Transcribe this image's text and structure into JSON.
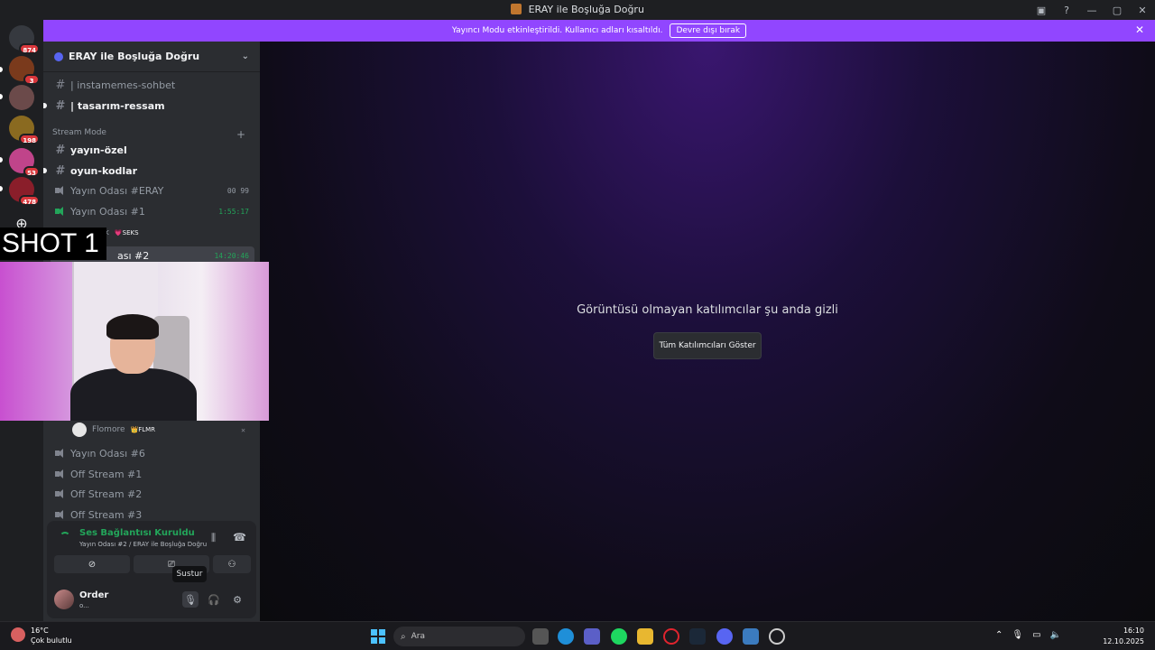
{
  "window": {
    "title": "ERAY ile Boşluğa Doğru"
  },
  "servers": [
    {
      "badge": "874"
    },
    {
      "badge": "3"
    },
    {
      "badge": ""
    },
    {
      "badge": "198"
    },
    {
      "badge": "53"
    },
    {
      "badge": "478"
    }
  ],
  "banner": {
    "text": "Yayıncı Modu etkinleştirildi. Kullanıcı adları kısaltıldı.",
    "button": "Devre dışı bırak"
  },
  "sidebar": {
    "server_name": "ERAY ile Boşluğa Doğru",
    "category": "Stream Mode",
    "channels": {
      "c1": "| instamemes-sohbet",
      "c2": "| tasarım-ressam",
      "c3": "yayın-özel",
      "c4": "oyun-kodlar",
      "v1": "Yayın Odası #ERAY",
      "v1_counts": "00 99",
      "v2": "Yayın Odası #1",
      "v2_time": "1:55:17",
      "v2_member": "rk",
      "v2_member_tag": "💗SEKS",
      "v3": "ası #2",
      "v3_time": "14:20:46",
      "member": "Flomore",
      "member_tag": "👑FLMR",
      "v4": "Yayın Odası #6",
      "v5": "Off Stream #1",
      "v6": "Off Stream #2",
      "v7": "Off Stream #3"
    }
  },
  "voice": {
    "status": "Ses Bağlantısı Kuruldu",
    "sub": "Yayın Odası #2 / ERAY ile Boşluğa Doğru",
    "user": "Order",
    "user_status": "o...",
    "tooltip": "Sustur"
  },
  "overlay": {
    "label": "SHOT 1"
  },
  "stage": {
    "message": "Görüntüsü olmayan katılımcılar şu anda gizli",
    "button": "Tüm Katılımcıları Göster"
  },
  "taskbar": {
    "temp": "16°C",
    "weather": "Çok bulutlu",
    "search": "Ara",
    "time": "16:10",
    "date": "12.10.2025"
  }
}
